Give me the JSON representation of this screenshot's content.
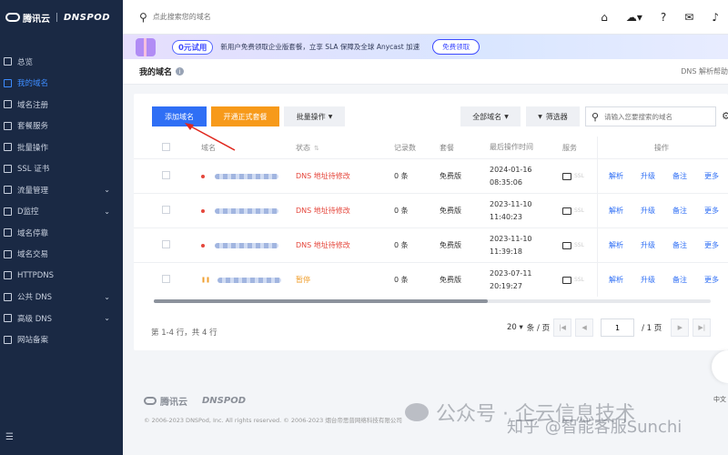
{
  "brand": {
    "logo_text": "腾讯云",
    "product": "DNSPOD"
  },
  "sidebar": {
    "items": [
      {
        "label": "总览",
        "icon": "grid-icon",
        "active": false,
        "chevron": false
      },
      {
        "label": "我的域名",
        "icon": "domain-icon",
        "active": true,
        "chevron": false
      },
      {
        "label": "域名注册",
        "icon": "register-icon",
        "active": false,
        "chevron": false
      },
      {
        "label": "套餐服务",
        "icon": "package-icon",
        "active": false,
        "chevron": false
      },
      {
        "label": "批量操作",
        "icon": "batch-icon",
        "active": false,
        "chevron": false
      },
      {
        "label": "SSL 证书",
        "icon": "ssl-icon",
        "active": false,
        "chevron": false
      },
      {
        "label": "流量管理",
        "icon": "traffic-icon",
        "active": false,
        "chevron": true
      },
      {
        "label": "D监控",
        "icon": "monitor-icon",
        "active": false,
        "chevron": true
      },
      {
        "label": "域名停靠",
        "icon": "parking-icon",
        "active": false,
        "chevron": false
      },
      {
        "label": "域名交易",
        "icon": "trade-icon",
        "active": false,
        "chevron": false
      },
      {
        "label": "HTTPDNS",
        "icon": "httpdns-icon",
        "active": false,
        "chevron": false
      },
      {
        "label": "公共 DNS",
        "icon": "public-dns-icon",
        "active": false,
        "chevron": true
      },
      {
        "label": "高级 DNS",
        "icon": "advanced-dns-icon",
        "active": false,
        "chevron": true
      },
      {
        "label": "网站备案",
        "icon": "icp-icon",
        "active": false,
        "chevron": false
      }
    ],
    "footer_icon": "menu-collapse-icon"
  },
  "topbar": {
    "search_placeholder": "点此搜索您的域名",
    "icons": [
      "home-icon",
      "cloud-icon",
      "help-icon",
      "wechat-icon",
      "bell-icon"
    ]
  },
  "banner": {
    "badge": "0元试用",
    "text": "新用户免费领取企业版套餐，立享 SLA 保障及全球 Anycast 加速",
    "button": "免费领取"
  },
  "page": {
    "title": "我的域名",
    "help_link": "DNS 解析帮助"
  },
  "toolbar": {
    "add_domain": "添加域名",
    "enable_plan": "开通正式套餐",
    "batch_ops": "批量操作",
    "all_domains": "全部域名",
    "filter": "筛选器",
    "search_placeholder": "请输入您要搜索的域名"
  },
  "table": {
    "headers": {
      "domain": "域名",
      "status": "状态",
      "records": "记录数",
      "plan": "套餐",
      "last_op_time": "最后操作时间",
      "service": "服务",
      "actions": "操作"
    },
    "rows": [
      {
        "status": "DNS 地址待修改",
        "status_kind": "warn",
        "records": "0 条",
        "plan": "免费版",
        "date": "2024-01-16",
        "time": "08:35:06"
      },
      {
        "status": "DNS 地址待修改",
        "status_kind": "warn",
        "records": "0 条",
        "plan": "免费版",
        "date": "2023-11-10",
        "time": "11:40:23"
      },
      {
        "status": "DNS 地址待修改",
        "status_kind": "warn",
        "records": "0 条",
        "plan": "免费版",
        "date": "2023-11-10",
        "time": "11:39:18"
      },
      {
        "status": "暂停",
        "status_kind": "paused",
        "records": "0 条",
        "plan": "免费版",
        "date": "2023-07-11",
        "time": "20:19:27"
      }
    ],
    "row_actions": [
      "解析",
      "升级",
      "备注",
      "更多"
    ],
    "service_text": "SSL"
  },
  "pagination": {
    "summary": "第 1-4 行，共 4 行",
    "page_size": "20",
    "page_size_unit": "条 / 页",
    "current_page": "1",
    "total_pages": "/ 1 页"
  },
  "footer": {
    "logo_text": "腾讯云",
    "product": "DNSPOD",
    "copyright": "© 2006-2023 DNSPod, Inc. All rights reserved. © 2006-2023 烟台帝思普网络科技有限公司"
  },
  "watermark": {
    "line1": "公众号 · 企云信息技术",
    "line2": "知乎 @智能客服Sunchi"
  },
  "lang": "中文",
  "colors": {
    "sidebar_bg": "#1a2944",
    "primary": "#2f6ff5",
    "orange": "#f79a1a",
    "warn_red": "#e5473c",
    "paused_orange": "#f0a030"
  }
}
